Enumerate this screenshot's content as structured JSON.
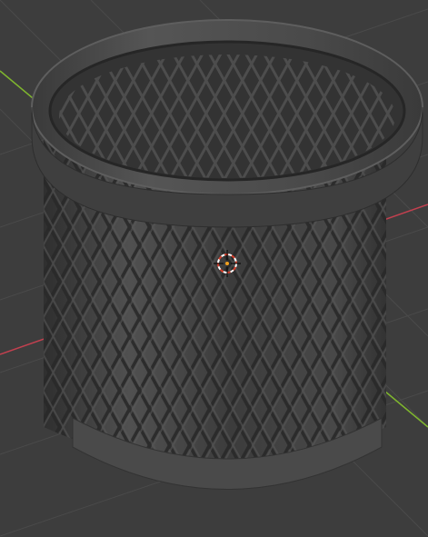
{
  "viewport": {
    "background": "#3d3d3d",
    "grid_color": "#4a4a4a",
    "x_axis_color": "#c2404f",
    "y_axis_color": "#7fb62e"
  },
  "object": {
    "kind": "mesh wastebasket",
    "color": "#454545"
  },
  "gizmo": {
    "icon": "3d-cursor-icon",
    "ring_colors": [
      "#d83e2a",
      "#ffffff"
    ]
  }
}
